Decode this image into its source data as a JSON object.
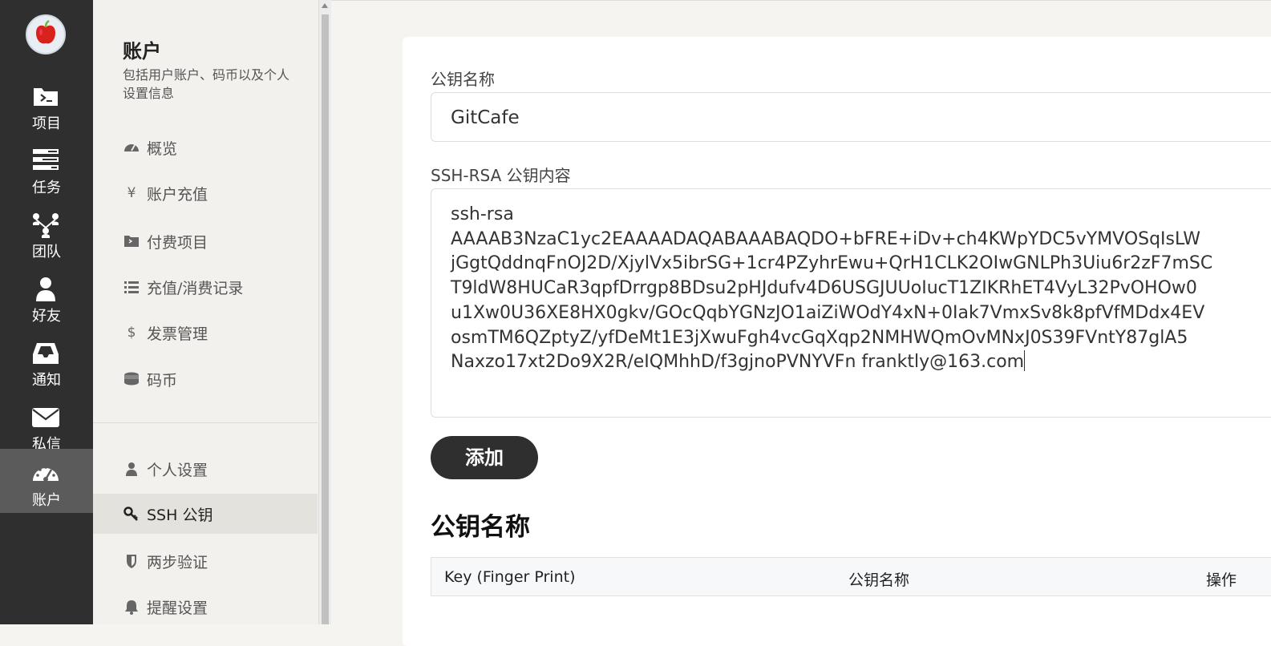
{
  "nav": {
    "items": [
      {
        "label": "项目",
        "icon": "folder-terminal-icon"
      },
      {
        "label": "任务",
        "icon": "tasks-icon"
      },
      {
        "label": "团队",
        "icon": "team-icon"
      },
      {
        "label": "好友",
        "icon": "user-icon"
      },
      {
        "label": "通知",
        "icon": "inbox-icon"
      },
      {
        "label": "私信",
        "icon": "envelope-icon"
      },
      {
        "label": "账户",
        "icon": "dashboard-icon",
        "active": true
      }
    ]
  },
  "sidebar": {
    "title": "账户",
    "description": "包括用户账户、码币以及个人设置信息",
    "items": [
      {
        "label": "概览",
        "icon": "dashboard-icon"
      },
      {
        "label": "账户充值",
        "icon": "yen-icon",
        "glyph": "¥"
      },
      {
        "label": "付费项目",
        "icon": "folder-terminal-icon"
      },
      {
        "label": "充值/消费记录",
        "icon": "list-icon"
      },
      {
        "label": "发票管理",
        "icon": "dollar-icon",
        "glyph": "$"
      },
      {
        "label": "码币",
        "icon": "coins-icon"
      },
      {
        "label": "个人设置",
        "icon": "user-icon"
      },
      {
        "label": "SSH 公钥",
        "icon": "key-icon",
        "active": true
      },
      {
        "label": "两步验证",
        "icon": "shield-icon"
      },
      {
        "label": "提醒设置",
        "icon": "bell-icon"
      }
    ]
  },
  "form": {
    "name_label": "公钥名称",
    "name_value": "GitCafe",
    "content_label": "SSH-RSA 公钥内容",
    "content_lines": [
      "ssh-rsa",
      "AAAAB3NzaC1yc2EAAAADAQABAAABAQDO+bFRE+iDv+ch4KWpYDC5vYMVOSqIsLW",
      "jGgtQddnqFnOJ2D/XjylVx5ibrSG+1cr4PZyhrEwu+QrH1CLK2OIwGNLPh3Uiu6r2zF7mSC",
      "T9ldW8HUCaR3qpfDrrgp8BDsu2pHJdufv4D6USGJUUoIucT1ZIKRhET4VyL32PvOHOw0",
      "u1Xw0U36XE8HX0gkv/GOcQqbYGNzJO1aiZiWOdY4xN+0Iak7VmxSv8k8pfVfMDdx4EV",
      "osmTM6QZptyZ/yfDeMt1E3jXwuFgh4vcGqXqp2NMHWQmOvMNxJ0S39FVntY87glA5",
      "Naxzo17xt2Do9X2R/eIQMhhD/f3gjnoPVNYVFn franktly@163.com"
    ],
    "submit_label": "添加"
  },
  "keys_section": {
    "heading": "公钥名称",
    "columns": [
      "Key (Finger Print)",
      "公钥名称",
      "操作"
    ]
  }
}
